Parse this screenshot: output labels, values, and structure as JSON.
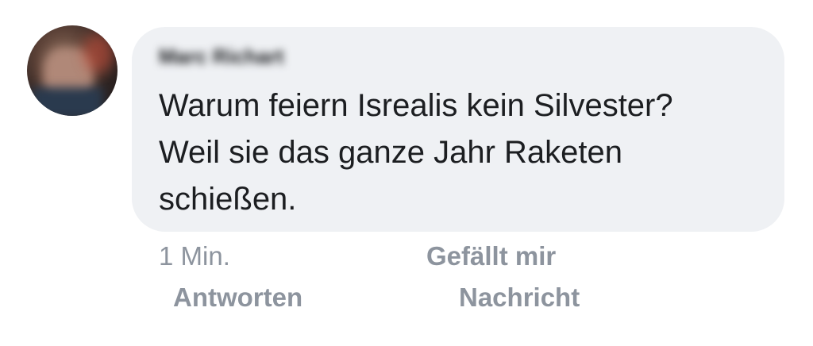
{
  "comment": {
    "author_name": "Marc Richart",
    "text_lines": [
      "Warum feiern Isrealis kein Silvester?",
      "Weil sie das ganze Jahr Raketen",
      "schießen."
    ],
    "timestamp": "1 Min.",
    "like_label": "Gefällt mir",
    "reply_label": "Antworten",
    "message_label": "Nachricht"
  },
  "colors": {
    "bubble_background": "#eff1f4",
    "text": "#1c1e21",
    "meta_text": "#8d949e"
  },
  "icons": {
    "avatar": "blurred-profile-photo"
  }
}
